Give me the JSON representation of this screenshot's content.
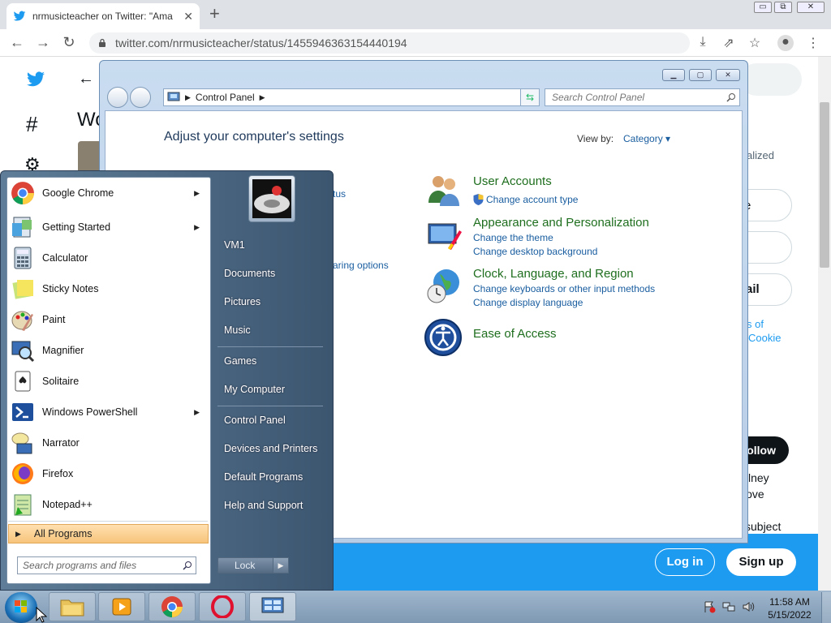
{
  "browser": {
    "tab_title": "nrmusicteacher on Twitter: \"Ama",
    "url": "twitter.com/nrmusicteacher/status/1455946363154440194",
    "window_minimize": "▭",
    "window_restore": "⧉",
    "window_close": "✕"
  },
  "twitter": {
    "heading_partial_1": "Wo",
    "right_text_1": "alized",
    "right_text_2": "e",
    "right_text_3": "ail",
    "right_link_1": "s of",
    "right_link_2": "Cookie",
    "follow_label": "ollow",
    "right_text_4": "lney",
    "right_text_5": "love",
    "right_text_6": "subject",
    "login_label": "Log in",
    "signup_label": "Sign up",
    "under_text_1": "tus",
    "under_text_2": "aring options"
  },
  "control_panel": {
    "breadcrumb": "Control Panel",
    "search_placeholder": "Search Control Panel",
    "page_title": "Adjust your computer's settings",
    "view_by_label": "View by:",
    "view_by_value": "Category",
    "categories": [
      {
        "title": "User Accounts",
        "links": [
          "Change account type"
        ]
      },
      {
        "title": "Appearance and Personalization",
        "links": [
          "Change the theme",
          "Change desktop background"
        ]
      },
      {
        "title": "Clock, Language, and Region",
        "links": [
          "Change keyboards or other input methods",
          "Change display language"
        ]
      },
      {
        "title": "Ease of Access",
        "links": []
      }
    ]
  },
  "start_menu": {
    "programs": [
      {
        "label": "Google Chrome",
        "icon": "chrome-icon",
        "submenu": true
      },
      {
        "label": "Getting Started",
        "icon": "getting-started-icon",
        "submenu": true
      },
      {
        "label": "Calculator",
        "icon": "calculator-icon",
        "submenu": false
      },
      {
        "label": "Sticky Notes",
        "icon": "sticky-notes-icon",
        "submenu": false
      },
      {
        "label": "Paint",
        "icon": "paint-icon",
        "submenu": false
      },
      {
        "label": "Magnifier",
        "icon": "magnifier-icon",
        "submenu": false
      },
      {
        "label": "Solitaire",
        "icon": "solitaire-icon",
        "submenu": false
      },
      {
        "label": "Windows PowerShell",
        "icon": "powershell-icon",
        "submenu": true
      },
      {
        "label": "Narrator",
        "icon": "narrator-icon",
        "submenu": false
      },
      {
        "label": "Firefox",
        "icon": "firefox-icon",
        "submenu": false
      },
      {
        "label": "Notepad++",
        "icon": "notepad-plus-plus-icon",
        "submenu": false
      }
    ],
    "all_programs_label": "All Programs",
    "search_placeholder": "Search programs and files",
    "right_items": [
      "VM1",
      "Documents",
      "Pictures",
      "Music",
      "Games",
      "My Computer",
      "Control Panel",
      "Devices and Printers",
      "Default Programs",
      "Help and Support"
    ],
    "lock_label": "Lock"
  },
  "taskbar": {
    "time": "11:58 AM",
    "date": "5/15/2022"
  },
  "colors": {
    "twitter_blue": "#1d9bf0",
    "cp_green": "#1e6e1e",
    "cp_link": "#1a5ea0"
  }
}
